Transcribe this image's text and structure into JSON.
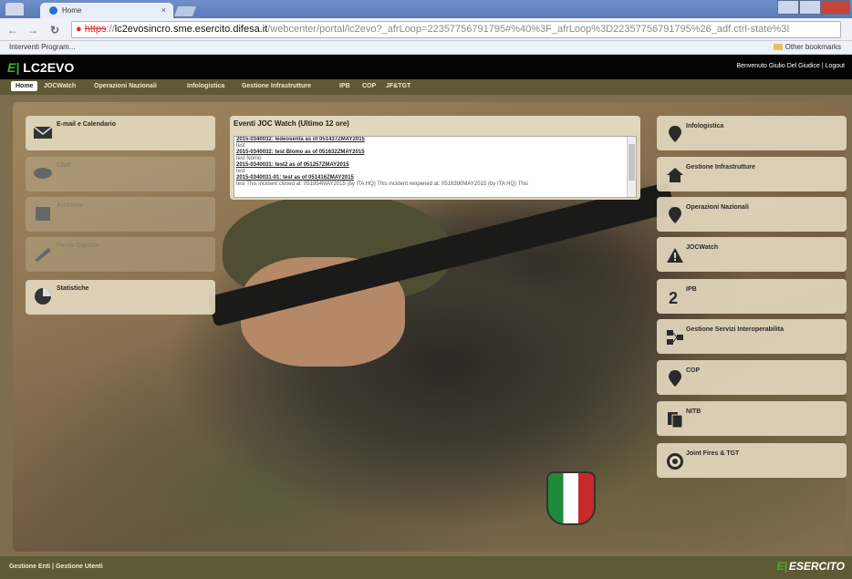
{
  "browser": {
    "tab_title": "Home",
    "tab_close": "×",
    "address": {
      "scheme": "https",
      "rest_scheme": "://",
      "host": "lc2evosincro.sme.esercito.difesa.it",
      "path": "/webcenter/portal/lc2evo?_afrLoop=22357756791795#%40%3F_afrLoop%3D22357756791795%26_adf.ctrl-state%3I"
    },
    "bookmarks_left": "Interventi Program...",
    "bookmarks_right": "Other bookmarks"
  },
  "app": {
    "logo_mark": "E|",
    "logo_text": "LC2EVO",
    "welcome": "Benvenuto Giulio Del Giudice  |  Logout",
    "nav": [
      "Home",
      "JOCWatch",
      "Operazioni Nazionali",
      "Infologistica",
      "Gestione Infrastrutture",
      "IPB",
      "COP",
      "JF&TGT"
    ]
  },
  "left_panels": [
    {
      "label": "E-mail e Calendario",
      "icon": "envelope-icon"
    },
    {
      "label": "Chat",
      "icon": "chat-icon"
    },
    {
      "label": "Archivio",
      "icon": "archive-icon"
    },
    {
      "label": "Firma Digitale",
      "icon": "pen-icon"
    },
    {
      "label": "Statistiche",
      "icon": "pie-chart-icon"
    }
  ],
  "events": {
    "title": "Eventi JOC Watch (Ultimo 12 ore)",
    "items": [
      {
        "link": "2015-0340032: ledeosenta as of 051437ZMAY2015",
        "note": "test"
      },
      {
        "link": "2015-0340032: test Blomo as of 051632ZMAY2015",
        "note": "test Nomo"
      },
      {
        "link": "2015-0340031: test2 as of 051257ZMAY2015",
        "note": "test"
      },
      {
        "link": "2015-0340031-01: test as of 051416ZMAY2015",
        "note": "test This incident closed at: 051954MAY2015 (by ITA HQ) This incident reopened at: 0516390MAY2015 (by ITA HQ) This"
      }
    ]
  },
  "right_panels": [
    {
      "label": "Infologistica",
      "icon": "map-pin-icon"
    },
    {
      "label": "Gestione Infrastrutture",
      "icon": "house-icon"
    },
    {
      "label": "Operazioni Nazionali",
      "icon": "map-pin-icon"
    },
    {
      "label": "JOCWatch",
      "icon": "warning-icon"
    },
    {
      "label": "IPB",
      "icon": "numeral-2-icon"
    },
    {
      "label": "Gestione Servizi Interoperabilita",
      "icon": "network-icon"
    },
    {
      "label": "COP",
      "icon": "map-pin-icon"
    },
    {
      "label": "NITB",
      "icon": "documents-icon"
    },
    {
      "label": "Joint Fires & TGT",
      "icon": "target-icon"
    }
  ],
  "footer": {
    "links": "Gestione Enti  |  Gestione Utenti",
    "brand": "ESERCITO",
    "brand_mark": "E|"
  }
}
